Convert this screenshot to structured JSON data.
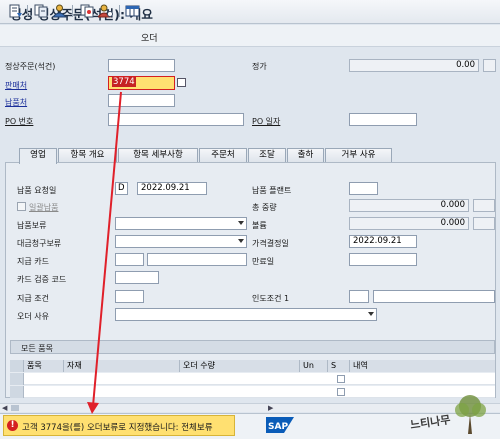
{
  "title": "생성 정상주문(석건): 개요",
  "toolbar": {
    "order_label": "오더"
  },
  "header": {
    "order_type_label": "정상주문(석건)",
    "net_value_label": "정가",
    "net_value": "0.00",
    "sold_to_label": "판매처",
    "sold_to_value": "3774",
    "ship_to_label": "납품처",
    "po_number_label": "PO 번호",
    "po_date_label": "PO 일자"
  },
  "tabs": [
    "영업",
    "항목 개요",
    "항목 세부사항",
    "주문처",
    "조달",
    "출하",
    "거부 사유"
  ],
  "sales": {
    "req_delivery_date_label": "납품 요청일",
    "req_delivery_date_prefix": "D",
    "req_delivery_date": "2022.09.21",
    "delivery_plant_label": "납품 플랜트",
    "complete_delivery_label": "일괄납품",
    "total_weight_label": "총 중량",
    "total_weight": "0.000",
    "delivery_block_label": "납품보류",
    "volume_label": "볼륨",
    "volume": "0.000",
    "billing_block_label": "대금청구보류",
    "pricing_date_label": "가격결정일",
    "pricing_date": "2022.09.21",
    "payment_card_label": "지급 카드",
    "expiry_date_label": "만료일",
    "card_verif_code_label": "카드 검증 코드",
    "payment_terms_label": "지급 조건",
    "incoterms_label": "인도조건 1",
    "order_reason_label": "오더 사유"
  },
  "items": {
    "section_label": "모든 품목",
    "columns": [
      "품목",
      "자재",
      "오더 수량",
      "Un",
      "S",
      "내역"
    ]
  },
  "status": {
    "message": "고객 3774을(를) 오더보류로 지정했습니다: 전체보류",
    "sap_logo": "SAP",
    "watermark": "느티나무"
  },
  "colors": {
    "error": "#d42020",
    "highlight": "#ffe071",
    "arrow": "#e0202a",
    "sap_blue": "#0a5cb8"
  }
}
